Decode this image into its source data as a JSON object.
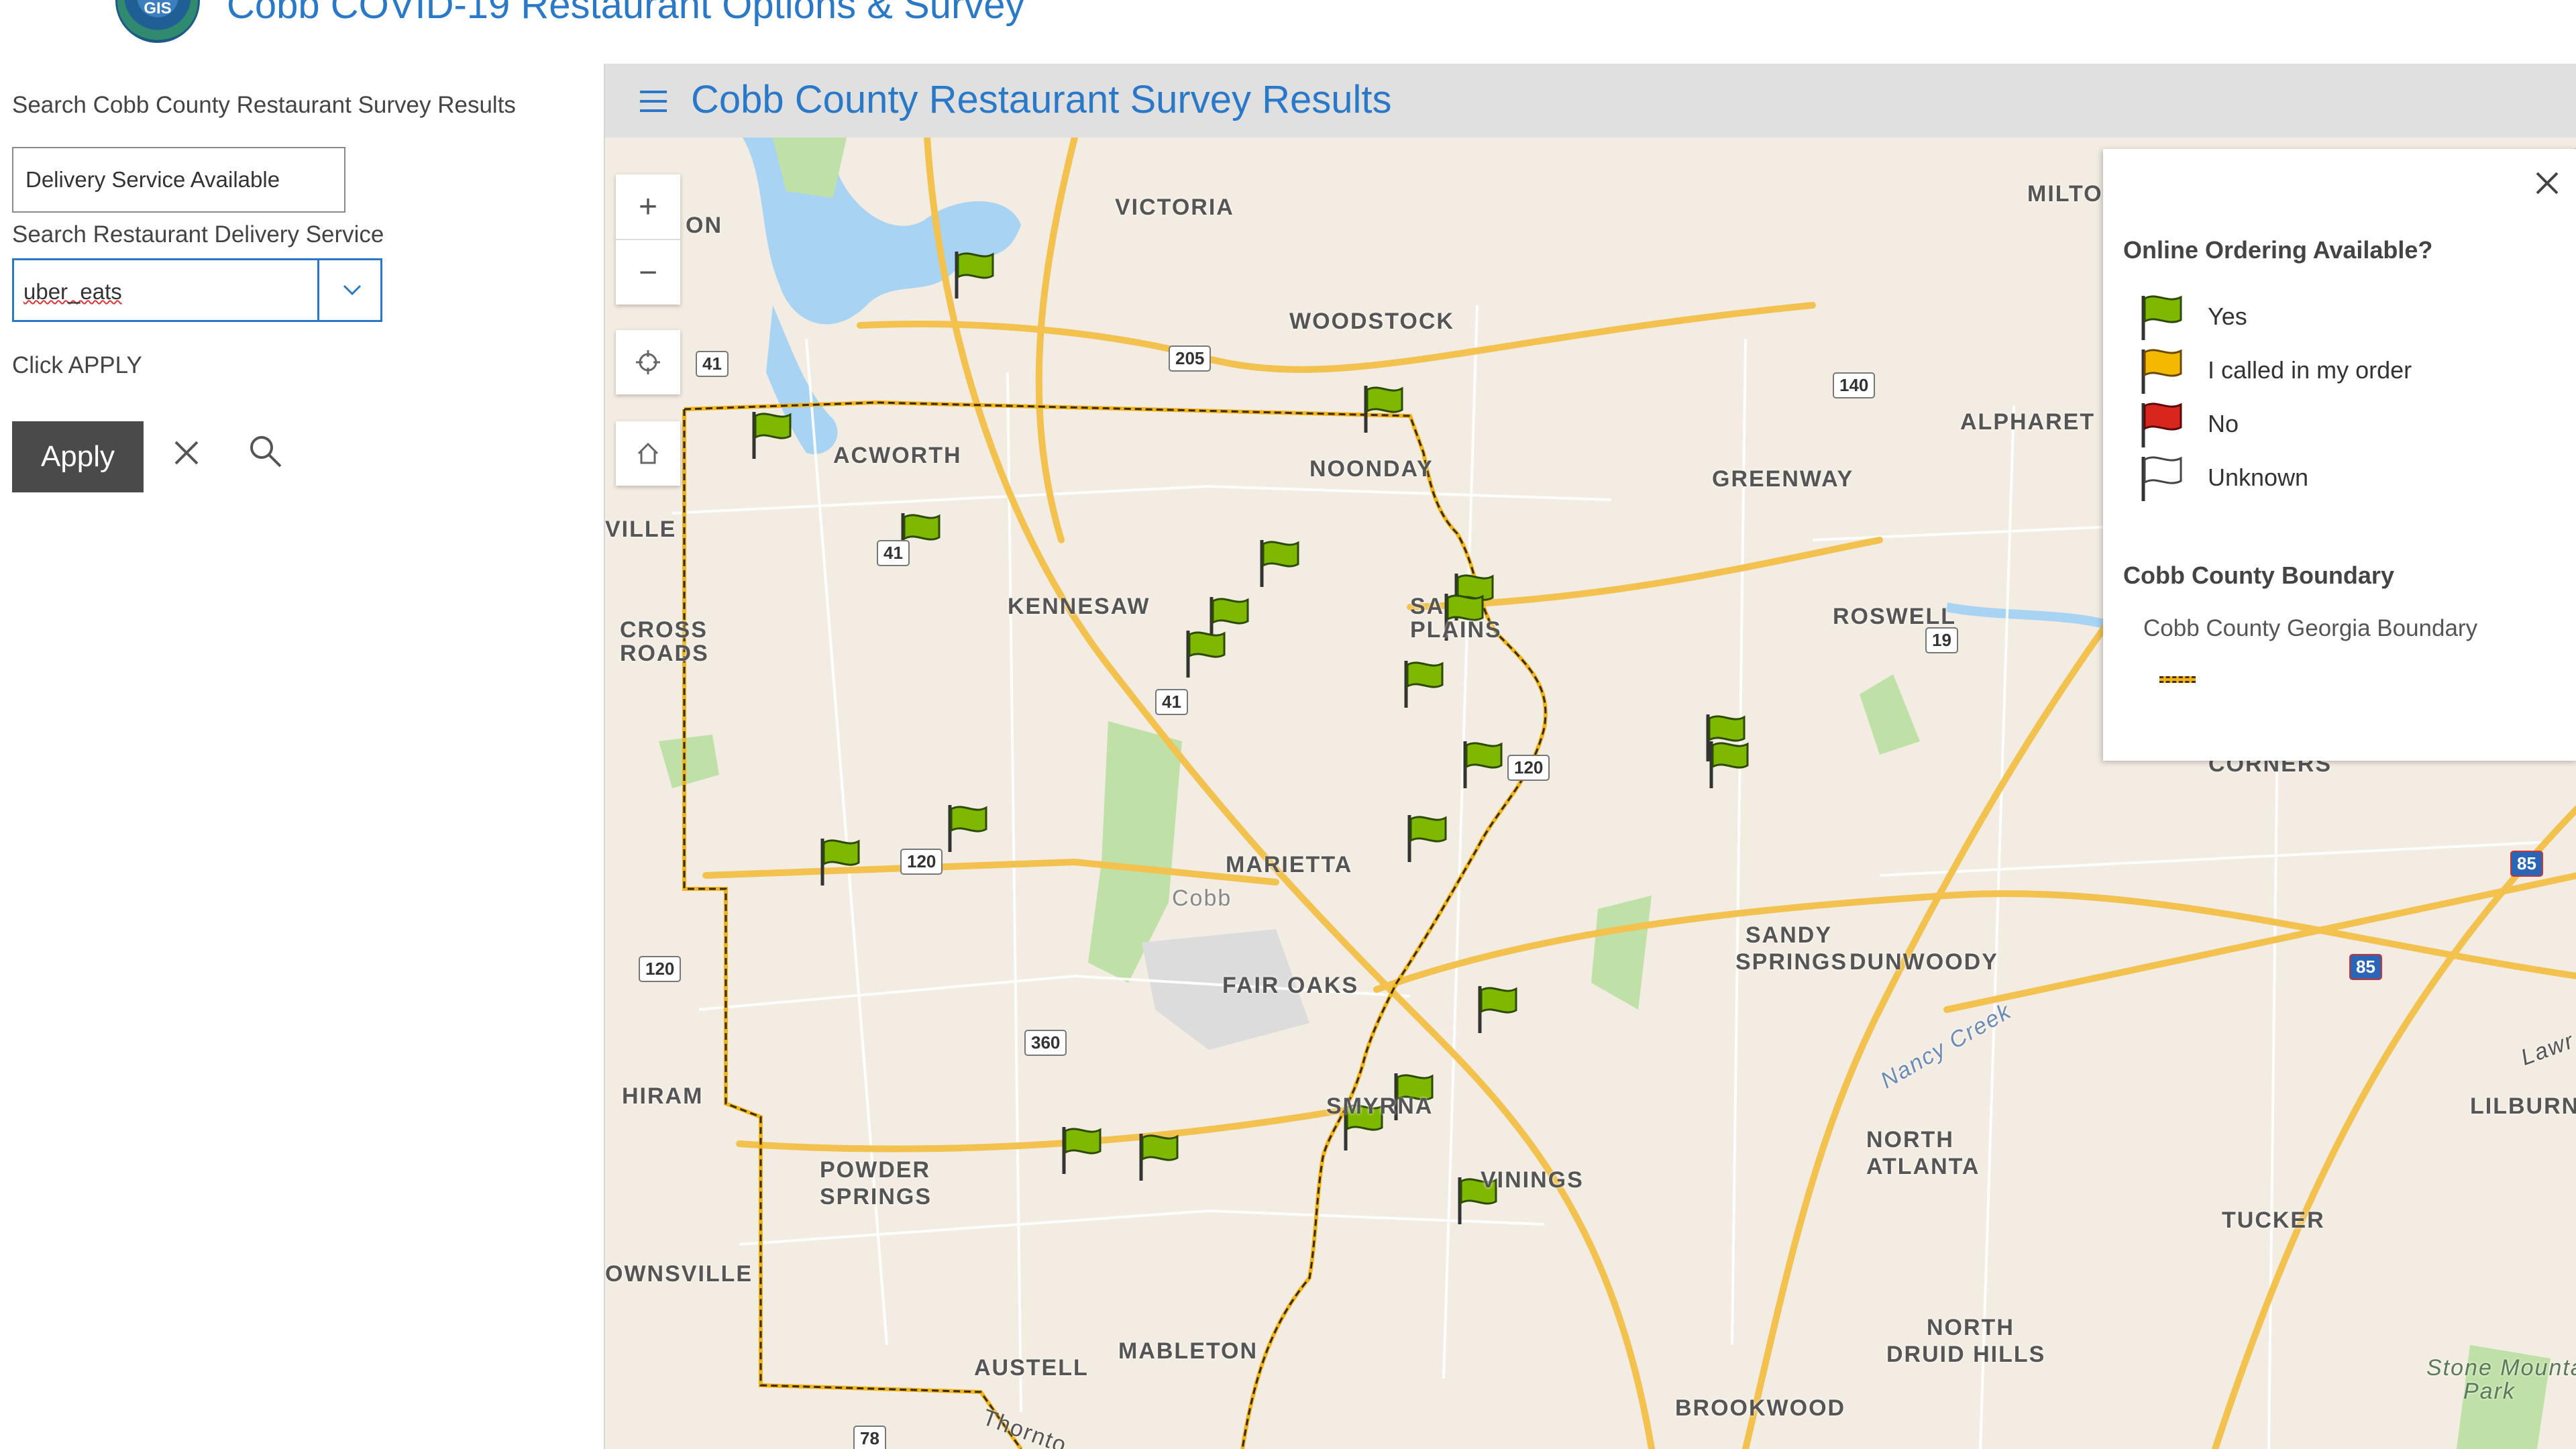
{
  "header": {
    "app_title": "Cobb COVID-19 Restaurant Options & Survey",
    "logo_text": "GIS"
  },
  "side": {
    "search_label": "Search Cobb County Restaurant Survey Results",
    "search_value": "Delivery Service Available",
    "delivery_label": "Search Restaurant Delivery Service",
    "delivery_value": "uber_eats",
    "instruction": "Click APPLY",
    "apply_label": "Apply"
  },
  "map": {
    "title": "Cobb County Restaurant Survey Results",
    "controls": {
      "zoom_in": "+",
      "zoom_out": "−"
    },
    "places": [
      "VICTORIA",
      "WOODSTOCK",
      "MILTO",
      "ACWORTH",
      "NOONDAY",
      "GREENWAY",
      "ALPHARET",
      "VILLE",
      "CROSS",
      "ROADS",
      "KENNESAW",
      "SA",
      "PLAINS",
      "ROSWELL",
      "CORNERS",
      "MARIETTA",
      "Cobb",
      "SANDY",
      "SPRINGS",
      "DUNWOODY",
      "FAIR OAKS",
      "HIRAM",
      "SMYRNA",
      "VININGS",
      "NORTH",
      "ATLANTA",
      "POWDER",
      "SPRINGS",
      "TUCKER",
      "LILBURN",
      "OWNSVILLE",
      "AUSTELL",
      "MABLETON",
      "NORTH",
      "DRUID HILLS",
      "Stone Mountain",
      "Park",
      "BROOKWOOD",
      "ON",
      "Nancy Creek",
      "Thornto",
      "Lawr"
    ],
    "shields": [
      "41",
      "205",
      "140",
      "41",
      "41",
      "120",
      "19",
      "120",
      "120",
      "360",
      "78",
      "85",
      "85",
      "19"
    ]
  },
  "legend": {
    "online_title": "Online Ordering Available?",
    "items": [
      {
        "label": "Yes",
        "color": "#7fb800"
      },
      {
        "label": "I called in my order",
        "color": "#f5b800"
      },
      {
        "label": "No",
        "color": "#d8261c"
      },
      {
        "label": "Unknown",
        "color": "#ffffff"
      }
    ],
    "boundary_title": "Cobb County Boundary",
    "boundary_sub": "Cobb County Georgia Boundary"
  },
  "colors": {
    "accent": "#2a79c9",
    "apply_bg": "#4a4a4a",
    "flag_yes": "#7fb800",
    "road": "#f2c14e",
    "water": "#a9d3f2",
    "park": "#bfe0a6"
  }
}
